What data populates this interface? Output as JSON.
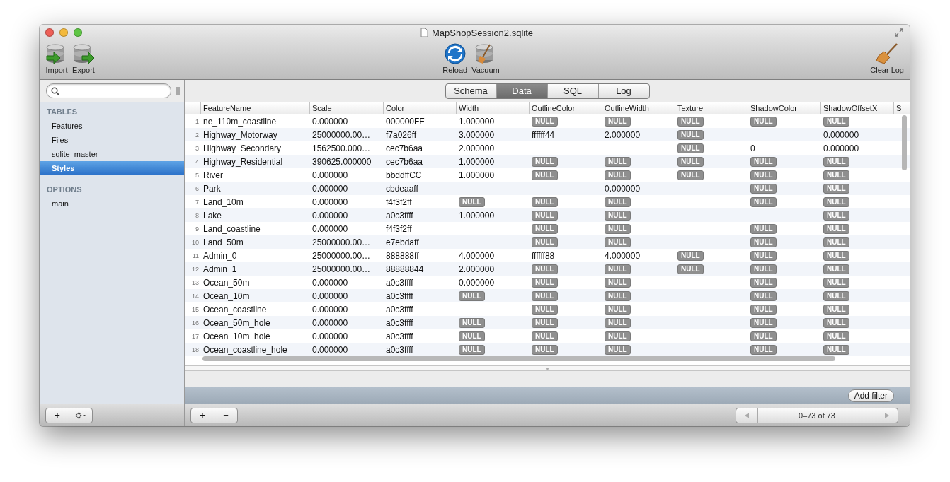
{
  "window": {
    "title": "MapShopSession2.sqlite"
  },
  "toolbar": {
    "left": [
      {
        "label": "Import",
        "kind": "import"
      },
      {
        "label": "Export",
        "kind": "export"
      }
    ],
    "center": [
      {
        "label": "Reload",
        "kind": "reload"
      },
      {
        "label": "Vacuum",
        "kind": "vacuum"
      }
    ],
    "right": [
      {
        "label": "Clear Log",
        "kind": "broom"
      }
    ]
  },
  "sidebar": {
    "sections": [
      {
        "title": "TABLES",
        "items": [
          {
            "label": "Features",
            "selected": false
          },
          {
            "label": "Files",
            "selected": false
          },
          {
            "label": "sqlite_master",
            "selected": false
          },
          {
            "label": "Styles",
            "selected": true
          }
        ]
      },
      {
        "title": "OPTIONS",
        "items": [
          {
            "label": "main",
            "selected": false
          }
        ]
      }
    ],
    "actions": [
      "+"
    ]
  },
  "tabs": [
    {
      "label": "Schema",
      "selected": false
    },
    {
      "label": "Data",
      "selected": true
    },
    {
      "label": "SQL",
      "selected": false
    },
    {
      "label": "Log",
      "selected": false
    }
  ],
  "table": {
    "columns": [
      "FeatureName",
      "Scale",
      "Color",
      "Width",
      "OutlineColor",
      "OutlineWidth",
      "Texture",
      "ShadowColor",
      "ShadowOffsetX",
      "S"
    ],
    "rows": [
      {
        "number": "1",
        "cells": [
          "ne_110m_coastline",
          "0.000000",
          "000000FF",
          "1.000000",
          "NULL",
          "NULL",
          "NULL",
          "NULL",
          "NULL"
        ]
      },
      {
        "number": "2",
        "cells": [
          "Highway_Motorway",
          "25000000.00…",
          "f7a026ff",
          "3.000000",
          "ffffff44",
          "2.000000",
          "NULL",
          null,
          "0.000000"
        ]
      },
      {
        "number": "3",
        "cells": [
          "Highway_Secondary",
          "1562500.000…",
          "cec7b6aa",
          "2.000000",
          null,
          null,
          "NULL",
          "0",
          "0.000000"
        ]
      },
      {
        "number": "4",
        "cells": [
          "Highway_Residential",
          "390625.000000",
          "cec7b6aa",
          "1.000000",
          "NULL",
          "NULL",
          "NULL",
          "NULL",
          "NULL"
        ]
      },
      {
        "number": "5",
        "cells": [
          "River",
          "0.000000",
          "bbddffCC",
          "1.000000",
          "NULL",
          "NULL",
          "NULL",
          "NULL",
          "NULL"
        ]
      },
      {
        "number": "6",
        "cells": [
          "Park",
          "0.000000",
          "cbdeaaff",
          null,
          null,
          "0.000000",
          null,
          "NULL",
          "NULL"
        ]
      },
      {
        "number": "7",
        "cells": [
          "Land_10m",
          "0.000000",
          "f4f3f2ff",
          "NULL",
          "NULL",
          "NULL",
          null,
          "NULL",
          "NULL"
        ]
      },
      {
        "number": "8",
        "cells": [
          "Lake",
          "0.000000",
          "a0c3ffff",
          "1.000000",
          "NULL",
          "NULL",
          null,
          null,
          "NULL"
        ]
      },
      {
        "number": "9",
        "cells": [
          "Land_coastline",
          "0.000000",
          "f4f3f2ff",
          null,
          "NULL",
          "NULL",
          null,
          "NULL",
          "NULL"
        ]
      },
      {
        "number": "10",
        "cells": [
          "Land_50m",
          "25000000.00…",
          "e7ebdaff",
          null,
          "NULL",
          "NULL",
          null,
          "NULL",
          "NULL"
        ]
      },
      {
        "number": "11",
        "cells": [
          "Admin_0",
          "25000000.00…",
          "888888ff",
          "4.000000",
          "ffffff88",
          "4.000000",
          "NULL",
          "NULL",
          "NULL"
        ]
      },
      {
        "number": "12",
        "cells": [
          "Admin_1",
          "25000000.00…",
          "88888844",
          "2.000000",
          "NULL",
          "NULL",
          "NULL",
          "NULL",
          "NULL"
        ]
      },
      {
        "number": "13",
        "cells": [
          "Ocean_50m",
          "0.000000",
          "a0c3ffff",
          "0.000000",
          "NULL",
          "NULL",
          null,
          "NULL",
          "NULL"
        ]
      },
      {
        "number": "14",
        "cells": [
          "Ocean_10m",
          "0.000000",
          "a0c3ffff",
          "NULL",
          "NULL",
          "NULL",
          null,
          "NULL",
          "NULL"
        ]
      },
      {
        "number": "15",
        "cells": [
          "Ocean_coastline",
          "0.000000",
          "a0c3ffff",
          null,
          "NULL",
          "NULL",
          null,
          "NULL",
          "NULL"
        ]
      },
      {
        "number": "16",
        "cells": [
          "Ocean_50m_hole",
          "0.000000",
          "a0c3ffff",
          "NULL",
          "NULL",
          "NULL",
          null,
          "NULL",
          "NULL"
        ]
      },
      {
        "number": "17",
        "cells": [
          "Ocean_10m_hole",
          "0.000000",
          "a0c3ffff",
          "NULL",
          "NULL",
          "NULL",
          null,
          "NULL",
          "NULL"
        ]
      },
      {
        "number": "18",
        "cells": [
          "Ocean_coastline_hole",
          "0.000000",
          "a0c3ffff",
          "NULL",
          "NULL",
          "NULL",
          null,
          "NULL",
          "NULL"
        ]
      }
    ]
  },
  "filter_bar": {
    "button": "Add filter"
  },
  "table_actions": [
    "+",
    "−"
  ],
  "pager": {
    "label": "0–73 of 73"
  }
}
